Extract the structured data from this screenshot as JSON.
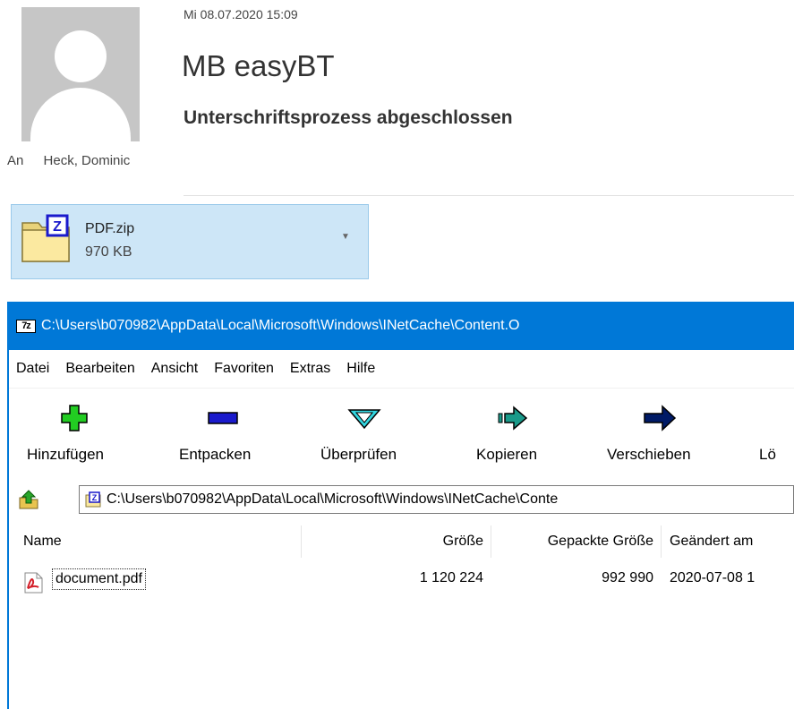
{
  "email": {
    "date": "Mi 08.07.2020 15:09",
    "sender": "MB easyBT",
    "subject": "Unterschriftsprozess abgeschlossen",
    "to_label": "An",
    "to_value": "Heck, Dominic"
  },
  "attachment": {
    "name": "PDF.zip",
    "size": "970 KB",
    "dropdown_glyph": "▼"
  },
  "sevenzip": {
    "logo_text": "7z",
    "title": "C:\\Users\\b070982\\AppData\\Local\\Microsoft\\Windows\\INetCache\\Content.O",
    "menu": [
      "Datei",
      "Bearbeiten",
      "Ansicht",
      "Favoriten",
      "Extras",
      "Hilfe"
    ],
    "toolbar": {
      "add": "Hinzufügen",
      "extract": "Entpacken",
      "test": "Überprüfen",
      "copy": "Kopieren",
      "move": "Verschieben",
      "delete": "Lö"
    },
    "address": "C:\\Users\\b070982\\AppData\\Local\\Microsoft\\Windows\\INetCache\\Conte",
    "columns": {
      "name": "Name",
      "size": "Größe",
      "packed": "Gepackte Größe",
      "modified": "Geändert am"
    },
    "files": [
      {
        "name": "document.pdf",
        "size": "1 120 224",
        "packed": "992 990",
        "modified": "2020-07-08 1"
      }
    ]
  },
  "icons": {
    "add": "green-plus-icon",
    "extract": "blue-minus-icon",
    "test": "cyan-check-icon",
    "copy": "teal-arrow-icon",
    "move": "navy-arrow-icon",
    "up": "folder-up-icon",
    "pdf": "pdf-file-icon",
    "zip": "zip-folder-icon"
  },
  "colors": {
    "titlebar": "#0078d7",
    "attachment_bg": "#cde6f7",
    "add_icon": "#22cc22",
    "extract_icon": "#1a1acc",
    "test_icon": "#33d6e0",
    "copy_icon": "#1a9a8a",
    "move_icon": "#001a66"
  }
}
